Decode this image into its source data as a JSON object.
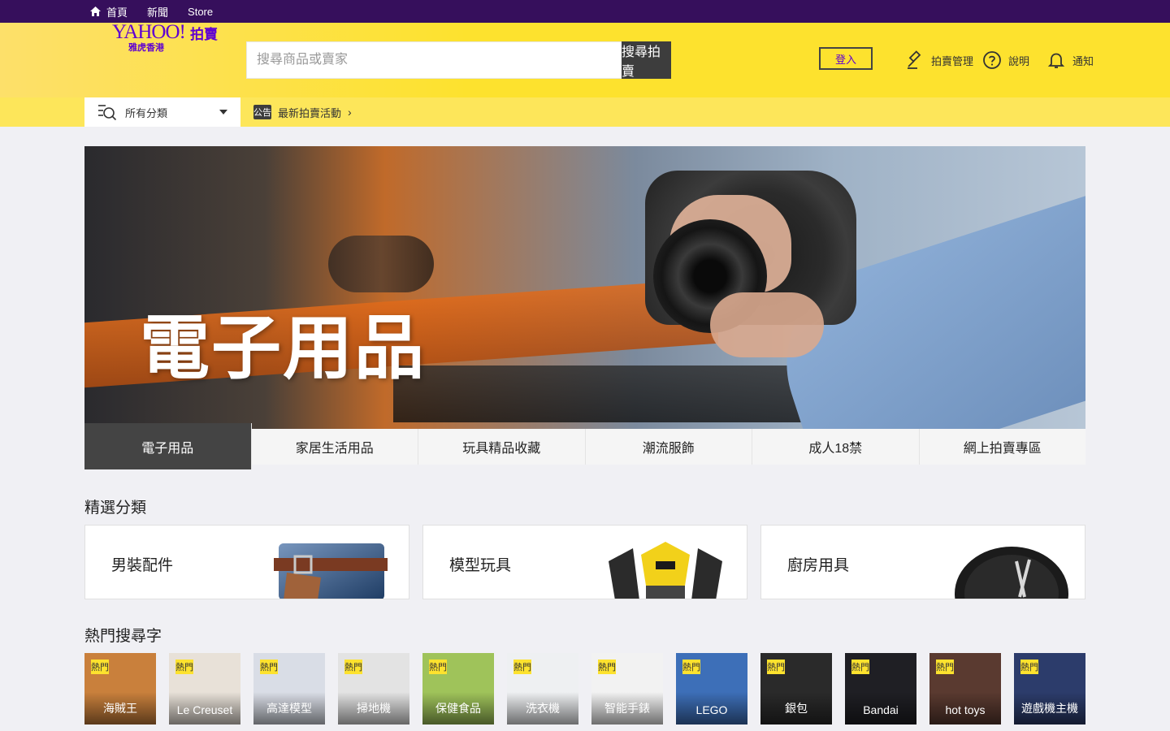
{
  "topbar": {
    "links": [
      {
        "label": "首頁",
        "icon": "home-icon"
      },
      {
        "label": "新聞"
      },
      {
        "label": "Store"
      }
    ]
  },
  "header": {
    "logo": {
      "brand": "YAHOO!",
      "product": "拍賣",
      "sub": "雅虎香港"
    },
    "search": {
      "placeholder": "搜尋商品或賣家",
      "button": "搜尋拍賣"
    },
    "login": "登入",
    "actions": [
      {
        "label": "拍賣管理",
        "icon": "gavel-icon"
      },
      {
        "label": "說明",
        "icon": "help-icon"
      },
      {
        "label": "通知",
        "icon": "bell-icon"
      }
    ]
  },
  "subbar": {
    "category": "所有分類",
    "announcement": {
      "tag": "公告",
      "text": "最新拍賣活動"
    }
  },
  "banner": {
    "title": "電子用品"
  },
  "tabs": [
    {
      "label": "電子用品",
      "active": true
    },
    {
      "label": "家居生活用品",
      "active": false
    },
    {
      "label": "玩具精品收藏",
      "active": false
    },
    {
      "label": "潮流服飾",
      "active": false
    },
    {
      "label": "成人18禁",
      "active": false
    },
    {
      "label": "網上拍賣專區",
      "active": false
    }
  ],
  "sections": {
    "featured_title": "精選分類",
    "popular_title": "熱門搜尋字"
  },
  "featured": [
    {
      "label": "男裝配件",
      "art": "jeans-belt-icon"
    },
    {
      "label": "模型玩具",
      "art": "robot-toy-icon"
    },
    {
      "label": "廚房用具",
      "art": "frying-pan-icon"
    }
  ],
  "hot_tag": "熱門",
  "thumbs": [
    {
      "label": "海賊王",
      "bg": "#c9803c"
    },
    {
      "label": "Le Creuset",
      "bg": "#e8e1d8"
    },
    {
      "label": "高達模型",
      "bg": "#d9dde6"
    },
    {
      "label": "掃地機",
      "bg": "#e3e3e3"
    },
    {
      "label": "保健食品",
      "bg": "#9fc35a"
    },
    {
      "label": "洗衣機",
      "bg": "#eef0f2"
    },
    {
      "label": "智能手錶",
      "bg": "#f2f2f2"
    },
    {
      "label": "LEGO",
      "bg": "#3d6fb8"
    },
    {
      "label": "銀包",
      "bg": "#2a2a2a"
    },
    {
      "label": "Bandai",
      "bg": "#1f1f24"
    },
    {
      "label": "hot toys",
      "bg": "#5a3a30"
    },
    {
      "label": "遊戲機主機",
      "bg": "#2c3c6b"
    }
  ]
}
